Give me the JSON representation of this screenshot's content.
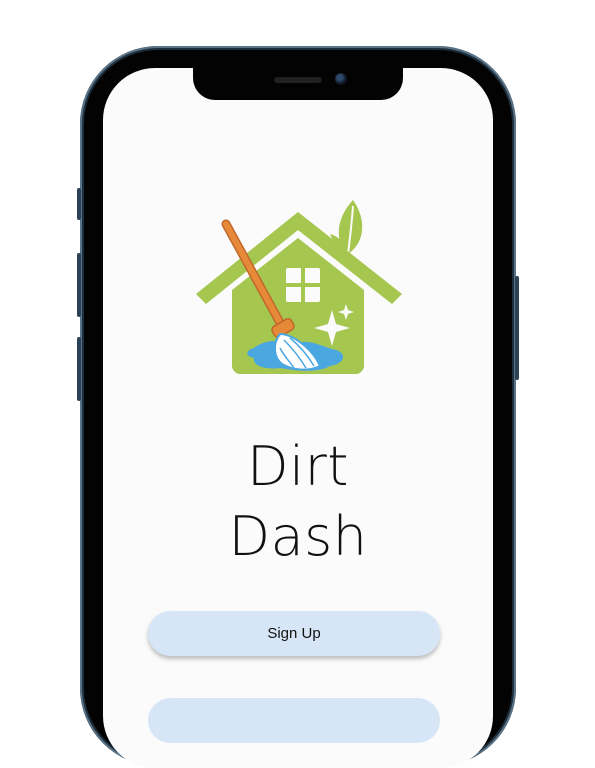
{
  "app": {
    "title_line1": "Dirt",
    "title_line2": "Dash"
  },
  "buttons": {
    "signup_label": "Sign Up"
  },
  "logo": {
    "icon": "house-cleaning-mop-icon",
    "house_color": "#a5c64f",
    "mop_handle_color": "#e68a3a",
    "water_color": "#4aa7e0"
  },
  "theme": {
    "button_bg": "#d7e6f7",
    "screen_bg": "#fbfbfb"
  }
}
